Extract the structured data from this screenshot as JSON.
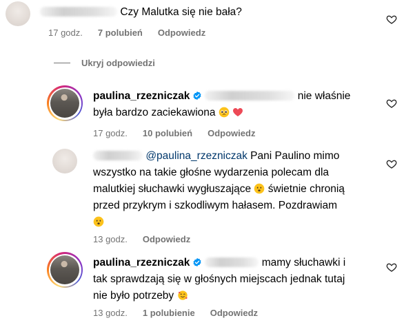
{
  "comment1": {
    "text": "Czy Malutka się nie bała?",
    "time": "17 godz.",
    "likes": "7 polubień",
    "reply": "Odpowiedz"
  },
  "hide_replies": "Ukryj odpowiedzi",
  "reply1": {
    "username": "paulina_rzezniczak",
    "text_a": "nie właśnie",
    "text_b": "była bardzo zaciekawiona",
    "time": "17 godz.",
    "likes": "10 polubień",
    "reply": "Odpowiedz"
  },
  "reply2": {
    "mention": "@paulina_rzezniczak",
    "line1": " Pani Paulino mimo",
    "line2": "wszystko na takie głośne wydarzenia polecam dla",
    "line3": "malutkiej słuchawki wygłuszające",
    "line3b": "świetnie chronią",
    "line4": "przed przykrym i szkodliwym hałasem. Pozdrawiam",
    "time": "13 godz.",
    "reply": "Odpowiedz"
  },
  "reply3": {
    "username": "paulina_rzezniczak",
    "text_a": "mamy słuchawki i",
    "line2": "tak sprawdzają się w głośnych miejscach jednak tutaj",
    "line3": "nie było potrzeby",
    "time": "13 godz.",
    "likes": "1 polubienie",
    "reply": "Odpowiedz"
  },
  "colors": {
    "verified": "#0095f6",
    "meta": "#737373",
    "mention": "#00376b",
    "heart_red": "#ed4956"
  }
}
